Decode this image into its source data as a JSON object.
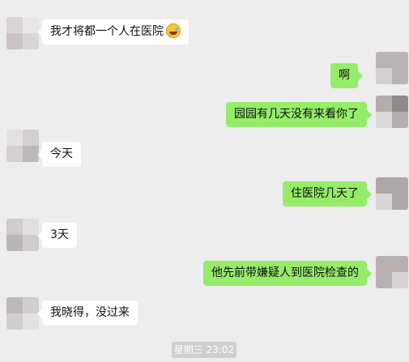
{
  "messages": [
    {
      "side": "left",
      "text": "我才将都一个人在医院",
      "emoji": "face-with-tears-of-joy-icon"
    },
    {
      "side": "right",
      "text": "啊"
    },
    {
      "side": "right",
      "text": "园园有几天没有来看你了"
    },
    {
      "side": "left",
      "text": "今天"
    },
    {
      "side": "right",
      "text": "住医院几天了"
    },
    {
      "side": "left",
      "text": "3天"
    },
    {
      "side": "right",
      "text": "他先前带嫌疑人到医院检查的"
    },
    {
      "side": "left",
      "text": "我晓得，没过来"
    }
  ],
  "timestamp": "星期三 23:02",
  "colors": {
    "background": "#ededed",
    "sent_bubble": "#95ec69",
    "received_bubble": "#ffffff"
  }
}
